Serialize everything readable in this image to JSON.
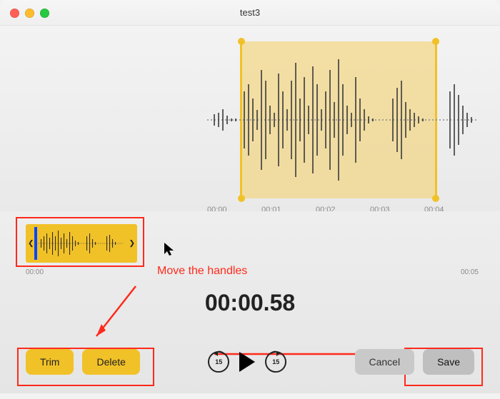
{
  "window": {
    "title": "test3"
  },
  "waveform": {
    "axis_ticks": [
      "00:00",
      "00:01",
      "00:02",
      "00:03",
      "00:04"
    ],
    "trim_start_sec": 0.5,
    "trim_end_sec": 4.1
  },
  "mini": {
    "start_label": "00:00",
    "end_label": "00:05"
  },
  "timer": {
    "display": "00:00.58"
  },
  "buttons": {
    "trim": "Trim",
    "delete": "Delete",
    "cancel": "Cancel",
    "save": "Save",
    "skip_seconds": "15"
  },
  "annotation": {
    "move_handles": "Move the handles"
  },
  "colors": {
    "accent": "#f1c128",
    "annotation": "#ff2a1b"
  }
}
